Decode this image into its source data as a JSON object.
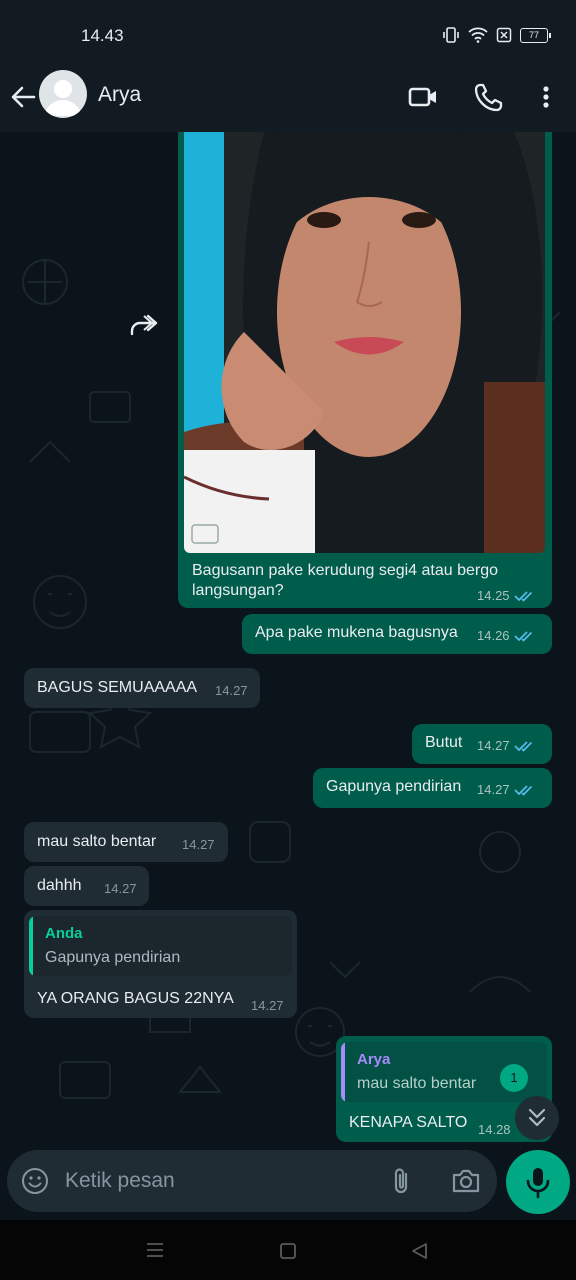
{
  "status": {
    "time": "14.43",
    "battery": "77"
  },
  "header": {
    "contact_name": "Arya"
  },
  "messages": [
    {
      "text": "Bagusann pake kerudung segi4 atau bergo",
      "text2": "langsungan?",
      "time": "14.25"
    },
    {
      "text": "Apa pake mukena bagusnya",
      "time": "14.26"
    },
    {
      "text": "BAGUS SEMUAAAAA",
      "time": "14.27"
    },
    {
      "text": "Butut",
      "time": "14.27"
    },
    {
      "text": "Gapunya pendirian",
      "time": "14.27"
    },
    {
      "text": "mau salto bentar",
      "time": "14.27"
    },
    {
      "text": "dahhh",
      "time": "14.27"
    },
    {
      "quote_author": "Anda",
      "quote_text": "Gapunya pendirian",
      "text": "YA ORANG BAGUS 22NYA",
      "time": "14.27"
    },
    {
      "quote_author": "Arya",
      "quote_text": "mau salto bentar",
      "text": "KENAPA SALTO",
      "time": "14.28"
    }
  ],
  "unread_count": "1",
  "input": {
    "placeholder": "Ketik pesan"
  },
  "colors": {
    "outgoing": "#005c4b",
    "incoming": "#1f2c34",
    "accent": "#00a884",
    "read_ticks": "#53bdeb"
  }
}
